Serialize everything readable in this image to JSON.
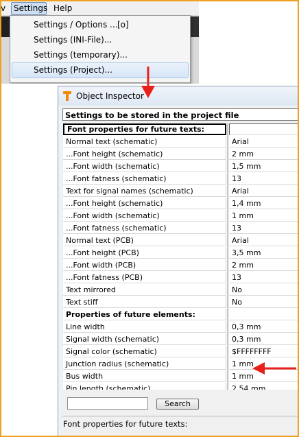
{
  "menubar": {
    "left_fragment": "v",
    "settings_label": "Settings",
    "help_label": "Help"
  },
  "settings_menu": [
    {
      "label": "Settings / Options ...",
      "shortcut": "[o]"
    },
    {
      "label": "Settings (INI-File)..."
    },
    {
      "label": "Settings (temporary)..."
    },
    {
      "label": "Settings (Project)...",
      "highlighted": true
    }
  ],
  "inspector": {
    "title": "Object Inspector",
    "header": "Settings to be stored in the project file",
    "rows": [
      {
        "label": "Font properties for future texts:",
        "value": "",
        "section": true
      },
      {
        "label": "Normal text (schematic)",
        "value": "Arial"
      },
      {
        "label": "...Font height (schematic)",
        "value": "2 mm"
      },
      {
        "label": "...Font width (schematic)",
        "value": "1,5 mm"
      },
      {
        "label": "...Font fatness (schematic)",
        "value": "13"
      },
      {
        "label": "Text for signal names (schematic)",
        "value": "Arial"
      },
      {
        "label": "...Font height (schematic)",
        "value": "1,4 mm"
      },
      {
        "label": "...Font width (schematic)",
        "value": "1 mm"
      },
      {
        "label": "...Font fatness (schematic)",
        "value": "13"
      },
      {
        "label": "Normal text (PCB)",
        "value": "Arial"
      },
      {
        "label": "...Font height (PCB)",
        "value": "3,5 mm"
      },
      {
        "label": "...Font width (PCB)",
        "value": "2 mm"
      },
      {
        "label": "...Font fatness (PCB)",
        "value": "13"
      },
      {
        "label": "Text mirrored",
        "value": "No"
      },
      {
        "label": "Text stiff",
        "value": "No"
      },
      {
        "label": "Properties of future elements:",
        "value": "",
        "section": true
      },
      {
        "label": "Line width",
        "value": "0,3 mm"
      },
      {
        "label": "Signal width (schematic)",
        "value": "0,3 mm"
      },
      {
        "label": "Signal color (schematic)",
        "value": "$FFFFFFFF"
      },
      {
        "label": "Junction radius (schematic)",
        "value": "1 mm"
      },
      {
        "label": "Bus width",
        "value": "1 mm"
      },
      {
        "label": "Pin length (schematic)",
        "value": "2,54 mm"
      }
    ],
    "search_placeholder": "",
    "search_button": "Search",
    "status": "Font properties for future texts:"
  },
  "colors": {
    "annotation_arrow": "#e8201a",
    "frame": "#f0a020",
    "title_icon": "#f08a00"
  },
  "icons": {
    "title": "object-inspector-icon",
    "annotation_down": "red-arrow-down-icon",
    "annotation_left": "red-arrow-left-icon"
  }
}
